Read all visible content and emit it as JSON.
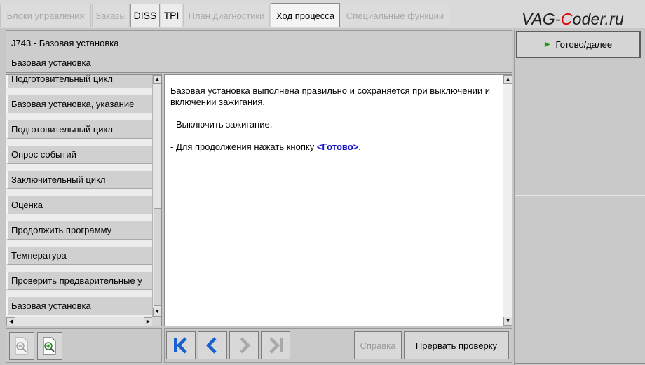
{
  "tabs": [
    {
      "label": "Блоки управления",
      "enabled": false
    },
    {
      "label": "Заказы",
      "enabled": false
    },
    {
      "label": "DISS",
      "enabled": true
    },
    {
      "label": "TPI",
      "enabled": true
    },
    {
      "label": "План диагностики",
      "enabled": false
    },
    {
      "label": "Ход процесса",
      "enabled": true,
      "active": true
    },
    {
      "label": "Специальные функции",
      "enabled": false
    }
  ],
  "watermark": {
    "prefix": "VAG-",
    "accent": "C",
    "suffix": "oder.ru"
  },
  "header": {
    "title": "J743 - Базовая установка",
    "subtitle": "Базовая установка"
  },
  "sidebar": {
    "items": [
      "Подготовительный цикл",
      "Базовая установка, указание",
      "Подготовительный цикл",
      "Опрос событий",
      "Заключительный цикл",
      "Оценка",
      "Продолжить программу",
      "Температура",
      "Проверить предварительные у",
      "Базовая установка"
    ]
  },
  "content": {
    "line1": "Базовая установка выполнена правильно и сохраняется при выключении и включении зажигания.",
    "line2": "- Выключить зажигание.",
    "line3_prefix": "- Для продолжения нажать кнопку ",
    "line3_highlight": "<Готово>",
    "line3_suffix": "."
  },
  "actions": {
    "done_label": "Готово/далее",
    "help_label": "Справка",
    "abort_label": "Прервать проверку"
  },
  "icons": {
    "zoom_out": "zoom-out-icon",
    "zoom_in": "zoom-in-icon",
    "first": "skip-first-icon",
    "prev": "chevron-left-icon",
    "next": "chevron-right-icon",
    "last": "skip-last-icon",
    "play": "play-icon"
  },
  "colors": {
    "accent_blue": "#1a5fd0",
    "highlight_text": "#1010c8",
    "play_green": "#1c9b1c",
    "brand_red": "#d40000"
  }
}
